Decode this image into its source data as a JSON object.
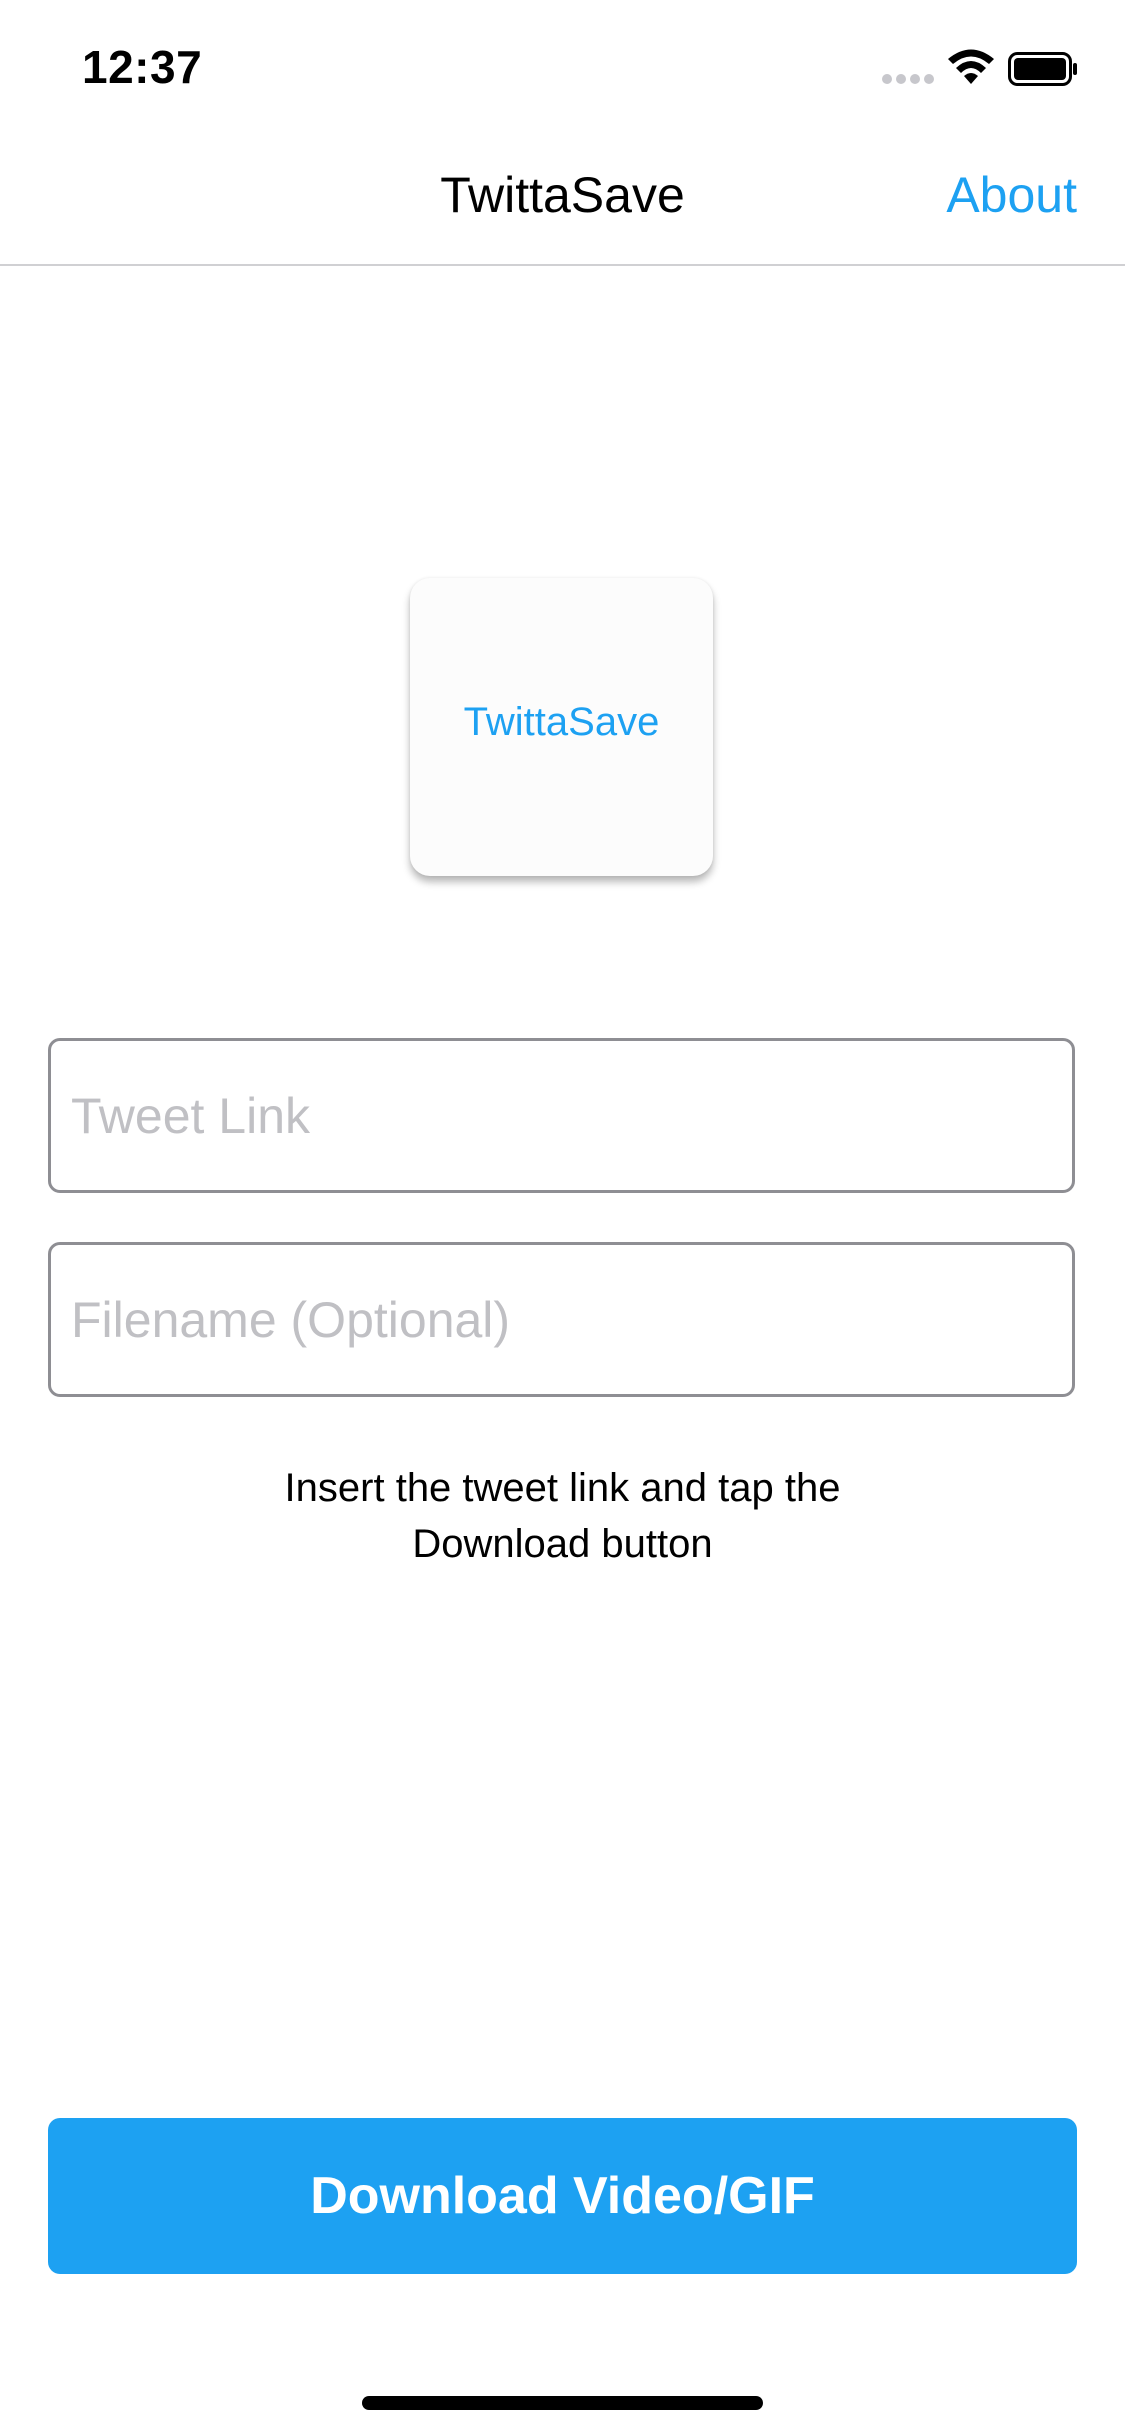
{
  "status_bar": {
    "time": "12:37",
    "icons": [
      "cellular-signal-icon",
      "wifi-icon",
      "battery-icon"
    ]
  },
  "nav": {
    "title": "TwittaSave",
    "about_label": "About"
  },
  "logo": {
    "text": "TwittaSave"
  },
  "form": {
    "tweet_link": {
      "value": "",
      "placeholder": "Tweet Link"
    },
    "filename": {
      "value": "",
      "placeholder": "Filename (Optional)"
    }
  },
  "instruction": {
    "line1": "Insert the tweet link and tap the",
    "line2": "Download button"
  },
  "download_button": {
    "label": "Download Video/GIF"
  },
  "colors": {
    "accent": "#1da1f2",
    "border": "#8e8e93",
    "placeholder": "#c0c0c4",
    "divider": "#d0d0d3"
  }
}
